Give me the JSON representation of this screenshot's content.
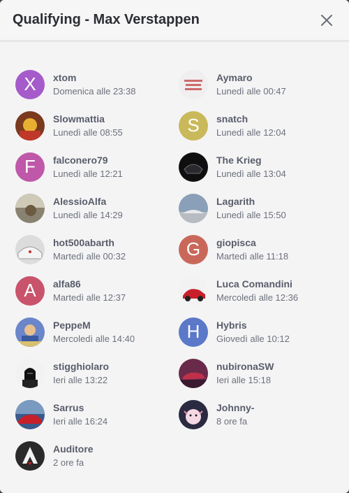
{
  "modal": {
    "title": "Qualifying - Max Verstappen"
  },
  "users": [
    {
      "name": "xtom",
      "time": "Domenica alle 23:38",
      "letter": "X",
      "color": "#a55bc9",
      "icon": "letter"
    },
    {
      "name": "Aymaro",
      "time": "Lunedì alle 00:47",
      "letter": "",
      "color": "#f0eeee",
      "icon": "text-sticker-avatar"
    },
    {
      "name": "Slowmattia",
      "time": "Lunedì alle 08:55",
      "letter": "",
      "color": "#7a3a1e",
      "icon": "cartoon-avatar"
    },
    {
      "name": "snatch",
      "time": "Lunedì alle 12:04",
      "letter": "S",
      "color": "#c9b95a",
      "icon": "letter"
    },
    {
      "name": "falconero79",
      "time": "Lunedì alle 12:21",
      "letter": "F",
      "color": "#bf58a8",
      "icon": "letter"
    },
    {
      "name": "The Krieg",
      "time": "Lunedì alle 13:04",
      "letter": "",
      "color": "#0f0f10",
      "icon": "dark-car-avatar"
    },
    {
      "name": "AlessioAlfa",
      "time": "Lunedì alle 14:29",
      "letter": "",
      "color": "#8a8270",
      "icon": "photo-avatar"
    },
    {
      "name": "Lagarith",
      "time": "Lunedì alle 15:50",
      "letter": "",
      "color": "#8aa0b8",
      "icon": "car-photo-avatar"
    },
    {
      "name": "hot500abarth",
      "time": "Martedì alle 00:32",
      "letter": "",
      "color": "#dcdcdc",
      "icon": "car-photo-avatar"
    },
    {
      "name": "giopisca",
      "time": "Martedì alle 11:18",
      "letter": "G",
      "color": "#c9685a",
      "icon": "letter"
    },
    {
      "name": "alfa86",
      "time": "Martedì alle 12:37",
      "letter": "A",
      "color": "#c9536a",
      "icon": "letter"
    },
    {
      "name": "Luca Comandini",
      "time": "Mercoledì alle 12:36",
      "letter": "",
      "color": "#f2f2f2",
      "icon": "red-car-avatar"
    },
    {
      "name": "PeppeM",
      "time": "Mercoledì alle 14:40",
      "letter": "",
      "color": "#6b86c9",
      "icon": "cartoon-avatar"
    },
    {
      "name": "Hybris",
      "time": "Giovedì alle 10:12",
      "letter": "H",
      "color": "#5b78c9",
      "icon": "letter"
    },
    {
      "name": "stigghiolaro",
      "time": "Ieri alle 13:22",
      "letter": "",
      "color": "#f2f2f2",
      "icon": "darth-vader-avatar"
    },
    {
      "name": "nubironaSW",
      "time": "Ieri alle 15:18",
      "letter": "",
      "color": "#6a2a4a",
      "icon": "car-photo-avatar"
    },
    {
      "name": "Sarrus",
      "time": "Ieri alle 16:24",
      "letter": "",
      "color": "#3a5a8a",
      "icon": "red-car-avatar"
    },
    {
      "name": "Johnny-",
      "time": "8 ore fa",
      "letter": "",
      "color": "#2a2a40",
      "icon": "axolotl-avatar"
    },
    {
      "name": "Auditore",
      "time": "2 ore fa",
      "letter": "",
      "color": "#2a2a2a",
      "icon": "assassin-logo-avatar"
    }
  ]
}
